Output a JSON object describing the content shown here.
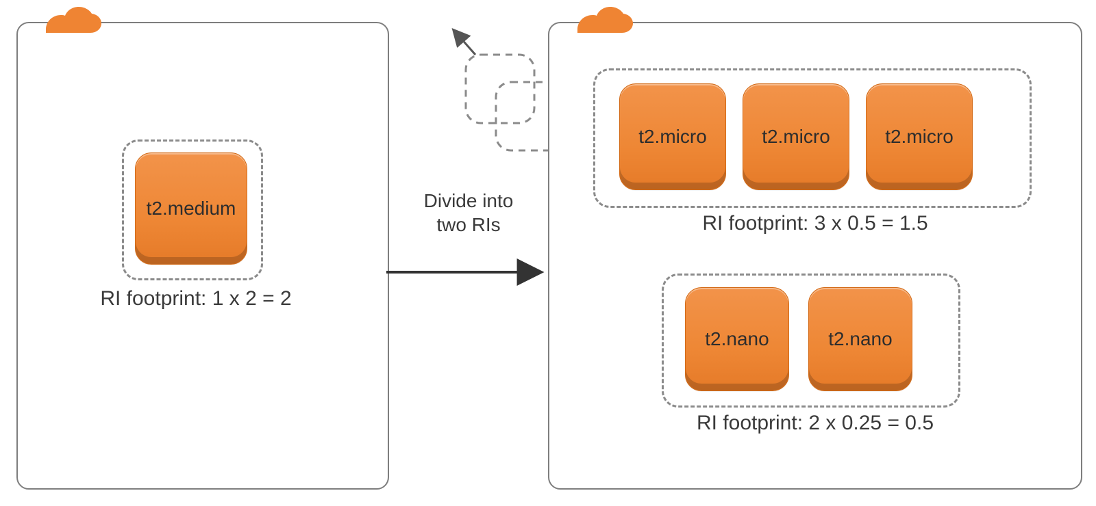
{
  "colors": {
    "accent": "#ef8433",
    "line": "#7e7e7e",
    "dash": "#8b8b8b"
  },
  "center": {
    "action_line1": "Divide into",
    "action_line2": "two RIs"
  },
  "left": {
    "instance_label": "t2.medium",
    "footprint": "RI footprint: 1 x 2 = 2"
  },
  "right": {
    "micro": {
      "labels": [
        "t2.micro",
        "t2.micro",
        "t2.micro"
      ],
      "footprint": "RI footprint: 3 x 0.5 = 1.5"
    },
    "nano": {
      "labels": [
        "t2.nano",
        "t2.nano"
      ],
      "footprint": "RI footprint: 2 x 0.25 = 0.5"
    }
  }
}
